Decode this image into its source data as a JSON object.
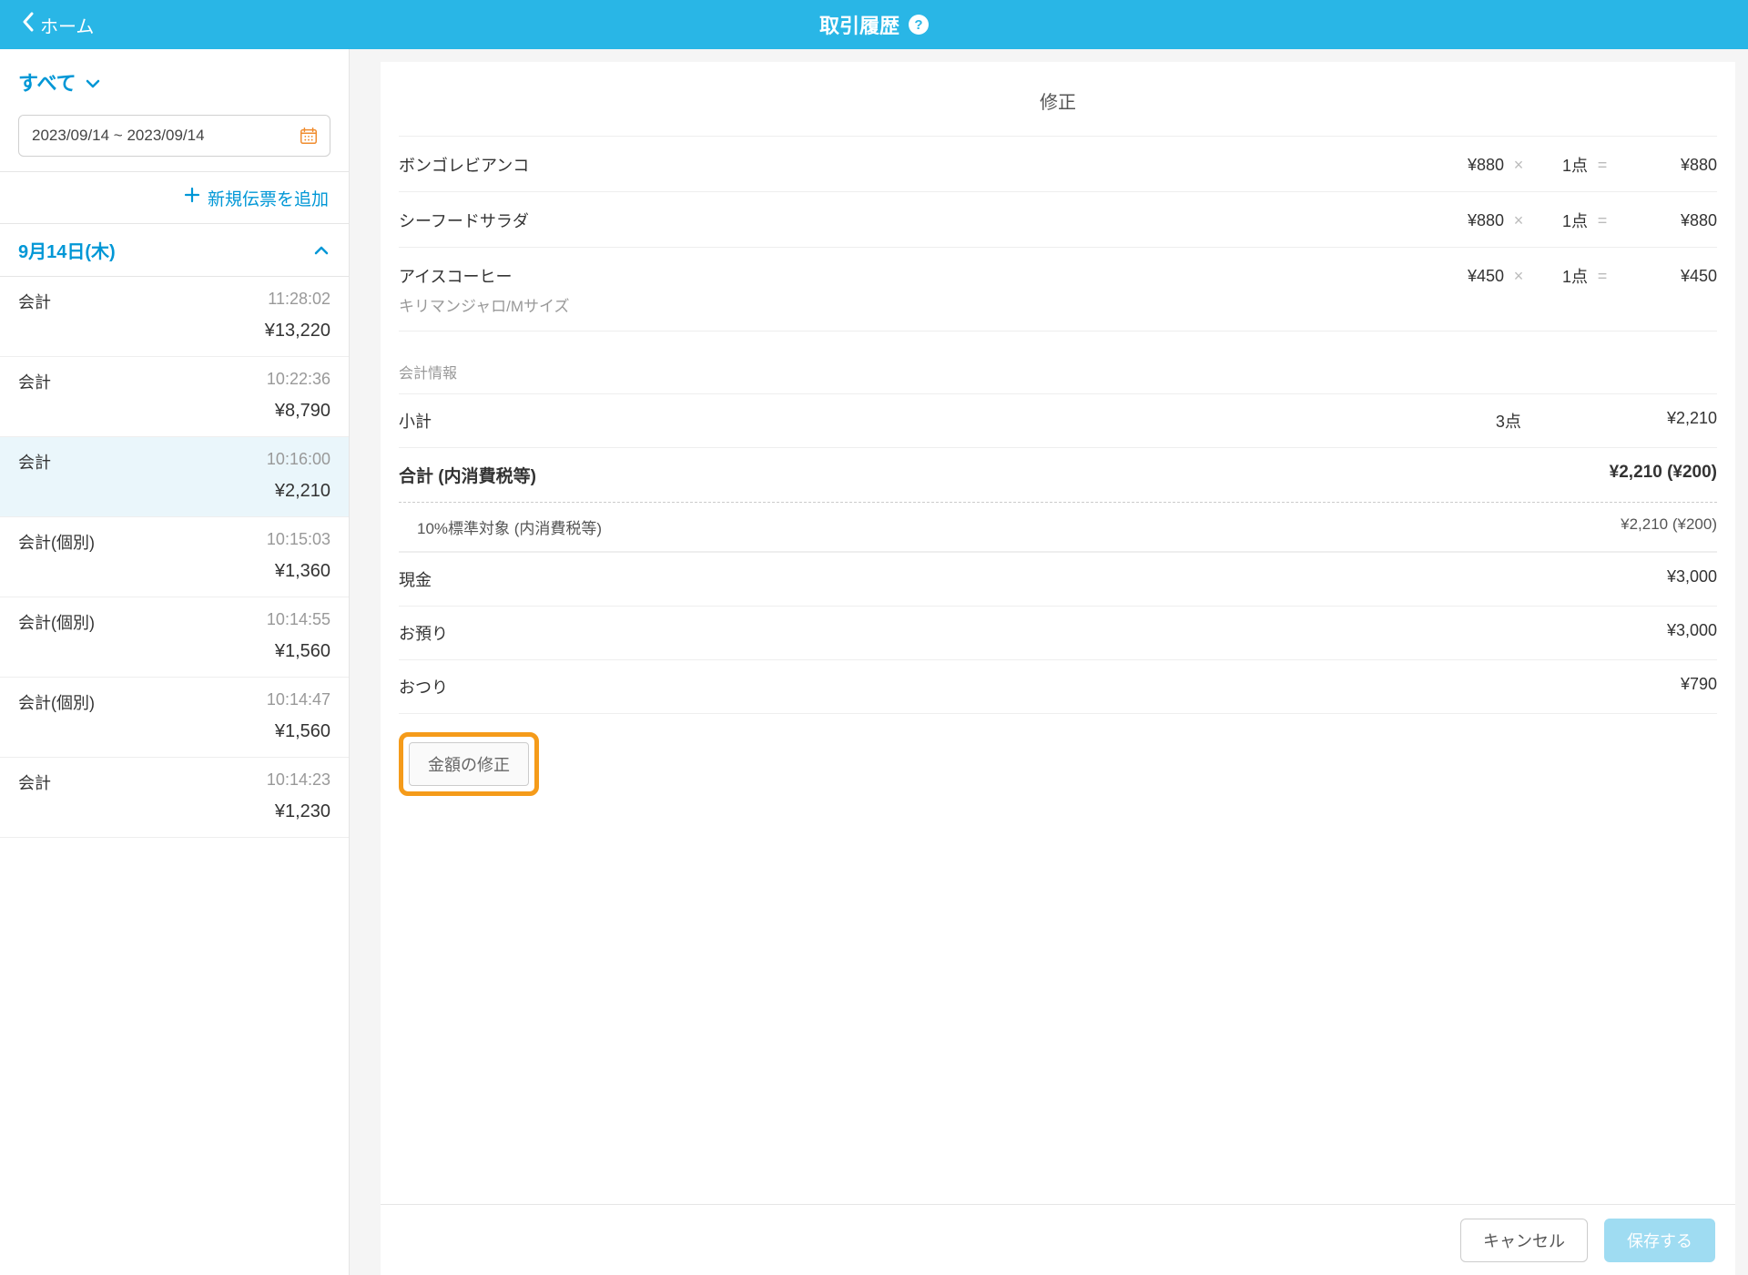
{
  "header": {
    "back_label": "ホーム",
    "title": "取引履歴",
    "help_glyph": "?"
  },
  "sidebar": {
    "filter_label": "すべて",
    "date_range": "2023/09/14 ~ 2023/09/14",
    "add_slip_label": "新規伝票を追加",
    "date_header": "9月14日(木)",
    "transactions": [
      {
        "label": "会計",
        "time": "11:28:02",
        "amount": "¥13,220",
        "selected": false
      },
      {
        "label": "会計",
        "time": "10:22:36",
        "amount": "¥8,790",
        "selected": false
      },
      {
        "label": "会計",
        "time": "10:16:00",
        "amount": "¥2,210",
        "selected": true
      },
      {
        "label": "会計(個別)",
        "time": "10:15:03",
        "amount": "¥1,360",
        "selected": false
      },
      {
        "label": "会計(個別)",
        "time": "10:14:55",
        "amount": "¥1,560",
        "selected": false
      },
      {
        "label": "会計(個別)",
        "time": "10:14:47",
        "amount": "¥1,560",
        "selected": false
      },
      {
        "label": "会計",
        "time": "10:14:23",
        "amount": "¥1,230",
        "selected": false
      }
    ]
  },
  "detail": {
    "panel_title": "修正",
    "times_sym": "×",
    "eq_sym": "=",
    "items": [
      {
        "name": "ボンゴレビアンコ",
        "sub": "",
        "unit": "¥880",
        "qty": "1点",
        "total": "¥880"
      },
      {
        "name": "シーフードサラダ",
        "sub": "",
        "unit": "¥880",
        "qty": "1点",
        "total": "¥880"
      },
      {
        "name": "アイスコーヒー",
        "sub": "キリマンジャロ/Mサイズ",
        "unit": "¥450",
        "qty": "1点",
        "total": "¥450"
      }
    ],
    "section_label": "会計情報",
    "subtotal": {
      "label": "小計",
      "qty": "3点",
      "amount": "¥2,210"
    },
    "total": {
      "label": "合計 (内消費税等)",
      "amount": "¥2,210 (¥200)"
    },
    "tax": {
      "label": "10%標準対象 (内消費税等)",
      "amount": "¥2,210 (¥200)"
    },
    "cash": {
      "label": "現金",
      "amount": "¥3,000"
    },
    "deposit": {
      "label": "お預り",
      "amount": "¥3,000"
    },
    "change": {
      "label": "おつり",
      "amount": "¥790"
    },
    "edit_button": "金額の修正"
  },
  "footer": {
    "cancel": "キャンセル",
    "save": "保存する"
  }
}
